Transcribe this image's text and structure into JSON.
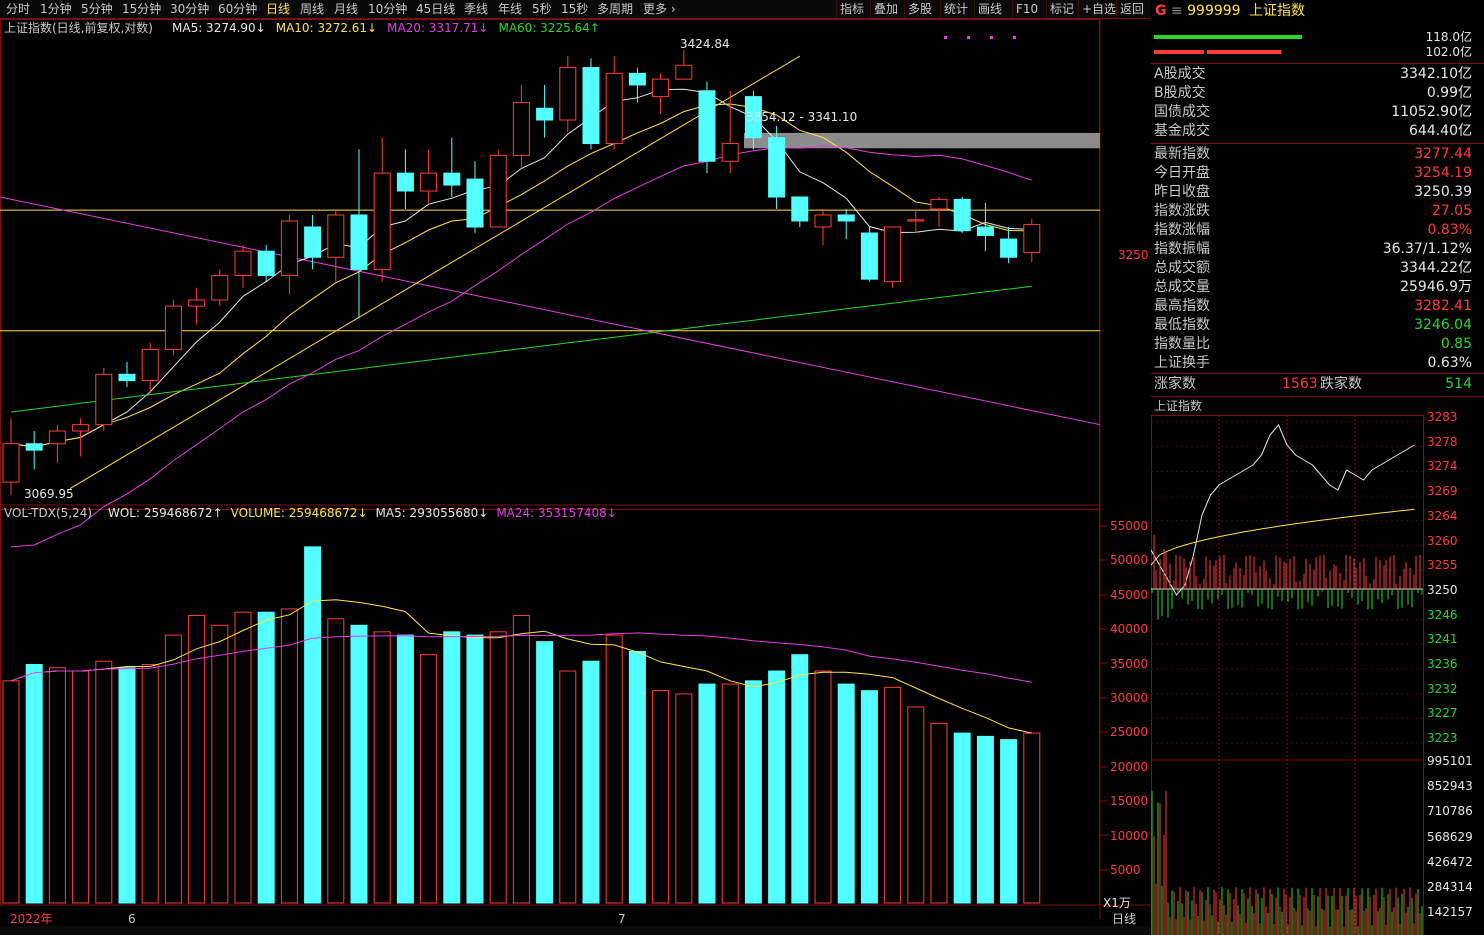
{
  "toolbar": {
    "periods": [
      "分时",
      "1分钟",
      "5分钟",
      "15分钟",
      "30分钟",
      "60分钟",
      "日线",
      "周线",
      "月线",
      "10分钟",
      "45日线",
      "季线",
      "年线",
      "5秒",
      "15秒",
      "多周期",
      "更多 ›"
    ],
    "active": "日线",
    "tools": [
      "指标",
      "叠加",
      "多股",
      "统计",
      "画线",
      "F10",
      "标记",
      "+自选",
      "返回"
    ]
  },
  "main_header": {
    "title": "上证指数(日线,前复权,对数)",
    "ma": [
      {
        "text": "MA5: 3274.90↓",
        "color": "#e6e6e6"
      },
      {
        "text": "MA10: 3272.61↓",
        "color": "#ffe24a"
      },
      {
        "text": "MA20: 3317.71↓",
        "color": "#e040e0"
      },
      {
        "text": "MA60: 3225.64↑",
        "color": "#2bd62b"
      }
    ]
  },
  "vol_header": {
    "title": "VOL-TDX(5,24)",
    "items": [
      {
        "text": "WOL: 259468672↑",
        "color": "#e6e6e6"
      },
      {
        "text": "VOLUME: 259468672↓",
        "color": "#ffe24a"
      },
      {
        "text": "MA5: 293055680↓",
        "color": "#e6e6e6"
      },
      {
        "text": "MA24: 353157408↓",
        "color": "#e040e0"
      }
    ]
  },
  "annotations": {
    "high": "3424.84",
    "low": "3069.95",
    "zone": "3354.12 - 3341.10",
    "price_tick": "3250"
  },
  "vol_axis": [
    "55000",
    "50000",
    "45000",
    "40000",
    "35000",
    "30000",
    "25000",
    "20000",
    "15000",
    "10000",
    "5000"
  ],
  "vol_unit": "X1万",
  "date_axis": [
    "2022年",
    "6",
    "7"
  ],
  "bottom_right_label": "日线",
  "right_panel": {
    "code": "999999",
    "name": "上证指数",
    "bar_values": [
      "118.0亿",
      "102.0亿"
    ],
    "turnover": [
      {
        "k": "A股成交",
        "v": "3342.10亿"
      },
      {
        "k": "B股成交",
        "v": "0.99亿"
      },
      {
        "k": "国债成交",
        "v": "11052.90亿"
      },
      {
        "k": "基金成交",
        "v": "644.40亿"
      }
    ],
    "stats": [
      {
        "k": "最新指数",
        "v": "3277.44",
        "c": "red"
      },
      {
        "k": "今日开盘",
        "v": "3254.19",
        "c": "red"
      },
      {
        "k": "昨日收盘",
        "v": "3250.39",
        "c": "white"
      },
      {
        "k": "指数涨跌",
        "v": "27.05",
        "c": "red"
      },
      {
        "k": "指数涨幅",
        "v": "0.83%",
        "c": "red"
      },
      {
        "k": "指数振幅",
        "v": "36.37/1.12%",
        "c": "white"
      },
      {
        "k": "总成交额",
        "v": "3344.22亿",
        "c": "white"
      },
      {
        "k": "总成交量",
        "v": "25946.9万",
        "c": "white"
      },
      {
        "k": "最高指数",
        "v": "3282.41",
        "c": "red"
      },
      {
        "k": "最低指数",
        "v": "3246.04",
        "c": "green"
      },
      {
        "k": "指数量比",
        "v": "0.85",
        "c": "green"
      },
      {
        "k": "上证换手",
        "v": "0.63%",
        "c": "white"
      }
    ],
    "up_label": "涨家数",
    "up": "1563",
    "down_label": "跌家数",
    "down": "514",
    "mini_title": "上证指数",
    "mini_price_axis": [
      "3283",
      "3278",
      "3274",
      "3269",
      "3264",
      "3260",
      "3255",
      "3250",
      "3246",
      "3241",
      "3236",
      "3232",
      "3227",
      "3223"
    ],
    "mini_vol_axis": [
      "995101",
      "852943",
      "710786",
      "568629",
      "426472",
      "284314",
      "142157"
    ]
  },
  "chart_data": {
    "type": "candlestick",
    "dates_marks": [
      "2022年",
      "6",
      "7"
    ],
    "candles": [
      [
        3070,
        3120,
        3060,
        3100
      ],
      [
        3100,
        3110,
        3080,
        3095
      ],
      [
        3100,
        3115,
        3085,
        3110
      ],
      [
        3110,
        3120,
        3090,
        3115
      ],
      [
        3115,
        3160,
        3110,
        3155
      ],
      [
        3155,
        3165,
        3145,
        3150
      ],
      [
        3150,
        3180,
        3140,
        3175
      ],
      [
        3175,
        3215,
        3170,
        3210
      ],
      [
        3210,
        3225,
        3195,
        3215
      ],
      [
        3215,
        3240,
        3210,
        3235
      ],
      [
        3235,
        3260,
        3225,
        3255
      ],
      [
        3255,
        3260,
        3230,
        3235
      ],
      [
        3235,
        3285,
        3220,
        3280
      ],
      [
        3275,
        3285,
        3240,
        3250
      ],
      [
        3250,
        3290,
        3230,
        3285
      ],
      [
        3285,
        3340,
        3200,
        3240
      ],
      [
        3240,
        3350,
        3230,
        3320
      ],
      [
        3320,
        3340,
        3290,
        3305
      ],
      [
        3305,
        3340,
        3295,
        3320
      ],
      [
        3320,
        3350,
        3300,
        3310
      ],
      [
        3315,
        3330,
        3270,
        3275
      ],
      [
        3275,
        3340,
        3275,
        3335
      ],
      [
        3335,
        3395,
        3325,
        3380
      ],
      [
        3375,
        3395,
        3350,
        3365
      ],
      [
        3365,
        3420,
        3355,
        3410
      ],
      [
        3410,
        3418,
        3340,
        3345
      ],
      [
        3345,
        3420,
        3340,
        3405
      ],
      [
        3405,
        3410,
        3380,
        3395
      ],
      [
        3385,
        3405,
        3370,
        3400
      ],
      [
        3400,
        3425,
        3400,
        3412
      ],
      [
        3390,
        3398,
        3320,
        3330
      ],
      [
        3330,
        3390,
        3320,
        3345
      ],
      [
        3385,
        3390,
        3340,
        3350
      ],
      [
        3350,
        3360,
        3290,
        3300
      ],
      [
        3300,
        3300,
        3275,
        3280
      ],
      [
        3275,
        3290,
        3260,
        3285
      ],
      [
        3285,
        3290,
        3265,
        3280
      ],
      [
        3270,
        3275,
        3230,
        3232
      ],
      [
        3230,
        3275,
        3225,
        3275
      ],
      [
        3280,
        3290,
        3270,
        3281
      ],
      [
        3290,
        3300,
        3275,
        3298
      ],
      [
        3298,
        3300,
        3270,
        3272
      ],
      [
        3275,
        3295,
        3255,
        3268
      ],
      [
        3265,
        3275,
        3245,
        3250
      ],
      [
        3254,
        3282,
        3246,
        3277
      ]
    ],
    "volumes": [
      34000,
      36500,
      36000,
      35500,
      37000,
      36000,
      36500,
      41000,
      44000,
      42500,
      44500,
      44500,
      45000,
      54500,
      43500,
      42500,
      41500,
      41000,
      38000,
      41500,
      41000,
      41500,
      44000,
      40000,
      35500,
      37000,
      41000,
      38500,
      32500,
      32000,
      33500,
      33500,
      34000,
      35500,
      38000,
      35500,
      33500,
      32500,
      33000,
      30000,
      27500,
      26000,
      25500,
      25000,
      26000
    ],
    "ylim": [
      3060,
      3440
    ],
    "vol_ylim": [
      0,
      58000
    ]
  }
}
